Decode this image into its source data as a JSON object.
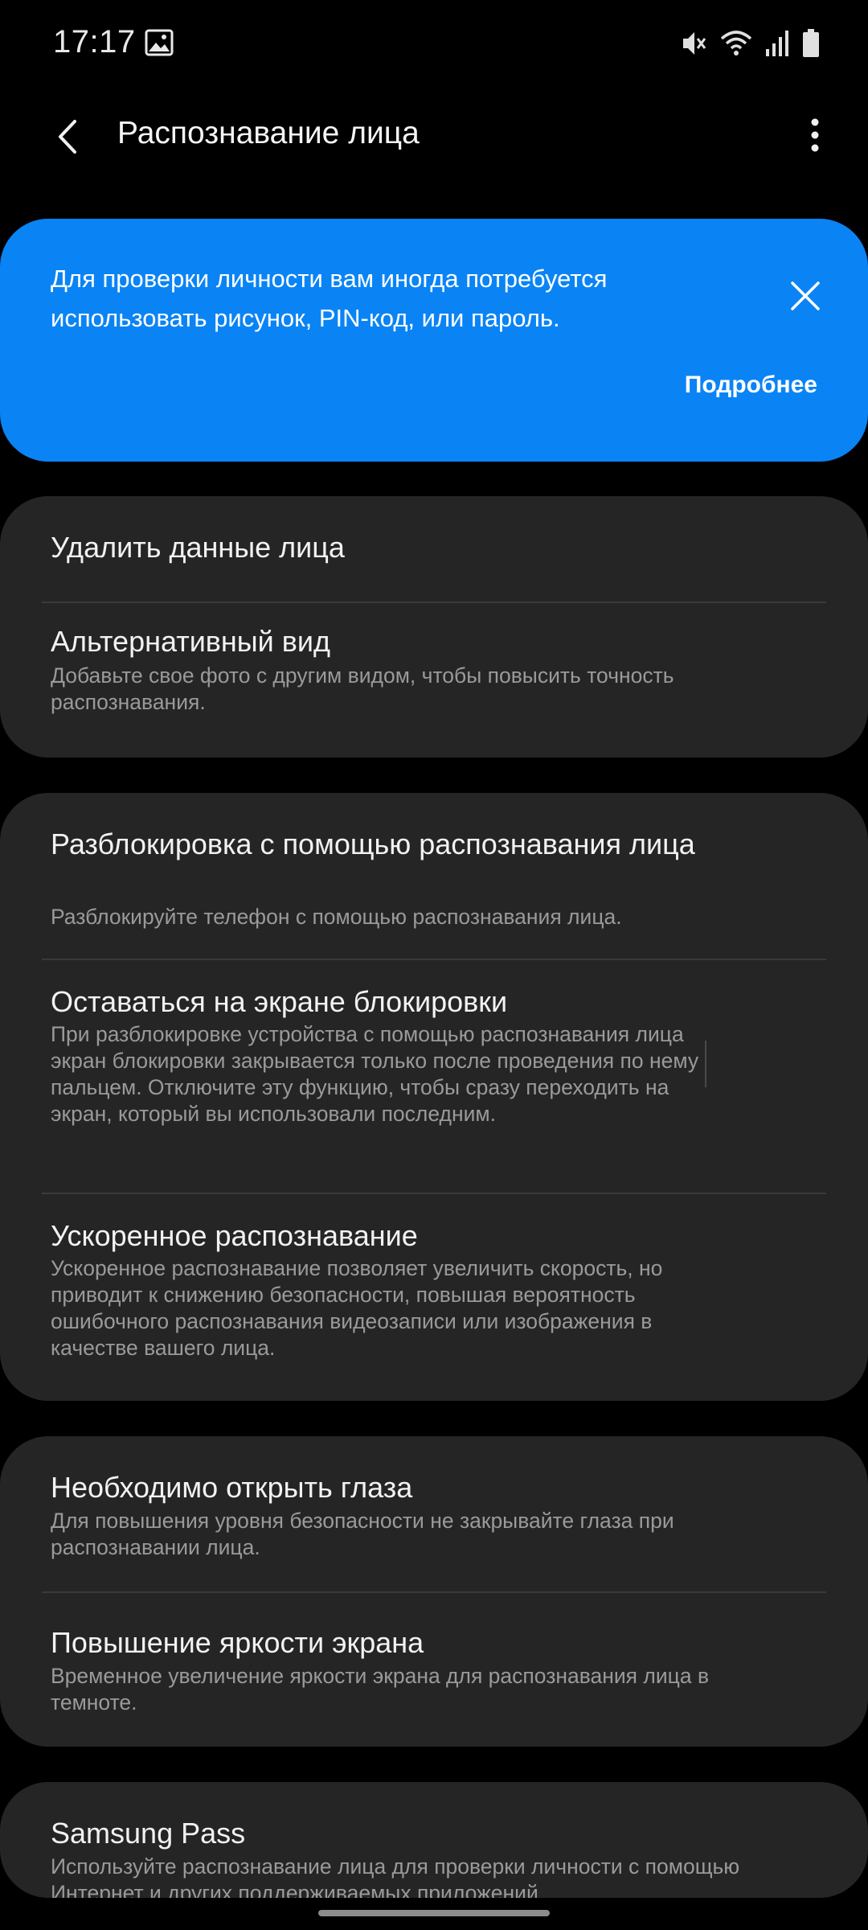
{
  "status_bar": {
    "time": "17:17",
    "icons": [
      "gallery-icon",
      "mute-icon",
      "wifi-icon",
      "signal-icon",
      "battery-icon"
    ]
  },
  "header": {
    "title": "Распознавание лица",
    "back_icon": "back-arrow-icon",
    "more_icon": "more-vert-icon"
  },
  "banner": {
    "text": "Для проверки личности вам иногда потребуется использовать рисунок, PIN-код, или пароль.",
    "link": "Подробнее",
    "color": "#0a84f5"
  },
  "card_data": {
    "delete_title": "Удалить данные лица",
    "alt_title": "Альтернативный вид",
    "alt_sub": "Добавьте свое фото с другим видом, чтобы повысить точность распознавания."
  },
  "card_unlock": {
    "items": [
      {
        "title": "Разблокировка с помощью распознавания лица",
        "sub": "Разблокируйте телефон с помощью распознавания лица.",
        "on": true
      },
      {
        "title": "Оставаться на экране блокировки",
        "sub": "При разблокировке устройства с помощью распознавания лица экран блокировки закрывается только после проведения по нему пальцем. Отключите эту функцию, чтобы сразу переходить на экран, который вы использовали последним.",
        "on": false
      },
      {
        "title": "Ускоренное распознавание",
        "sub": "Ускоренное распознавание позволяет увеличить скорость, но приводит к снижению безопасности, повышая вероятность ошибочного распознавания видеозаписи или изображения в качестве вашего лица.",
        "on": true
      }
    ]
  },
  "card_security": {
    "items": [
      {
        "title": "Необходимо открыть глаза",
        "sub": "Для повышения уровня безопасности не закрывайте глаза при распознавании лица.",
        "on": true
      },
      {
        "title": "Повышение яркости экрана",
        "sub": "Временное увеличение яркости экрана для распознавания лица в темноте.",
        "on": true
      }
    ]
  },
  "card_pass": {
    "title": "Samsung Pass",
    "sub": "Используйте распознавание лица для проверки личности с помощью Интернет и других поддерживаемых приложений."
  }
}
